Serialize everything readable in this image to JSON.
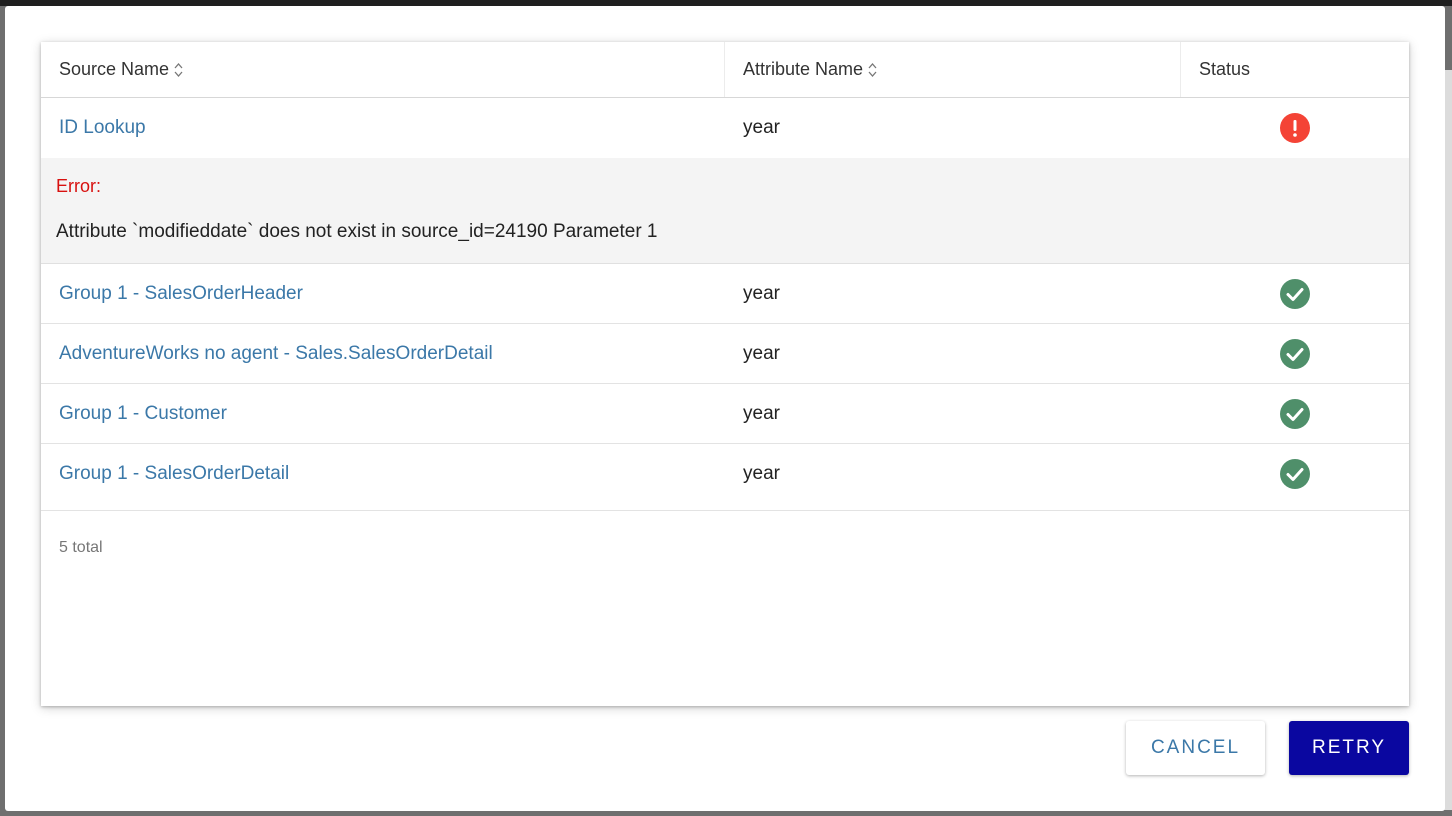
{
  "table": {
    "headers": {
      "source": "Source Name",
      "attribute": "Attribute Name",
      "status": "Status"
    },
    "rows": [
      {
        "source": "ID Lookup",
        "attribute": "year",
        "status": "error"
      },
      {
        "source": "Group 1 - SalesOrderHeader",
        "attribute": "year",
        "status": "success"
      },
      {
        "source": "AdventureWorks no agent - Sales.SalesOrderDetail",
        "attribute": "year",
        "status": "success"
      },
      {
        "source": "Group 1 - Customer",
        "attribute": "year",
        "status": "success"
      },
      {
        "source": "Group 1 - SalesOrderDetail",
        "attribute": "year",
        "status": "success"
      }
    ],
    "error": {
      "label": "Error:",
      "message": "Attribute `modifieddate` does not exist in source_id=24190 Parameter 1"
    },
    "total": "5 total"
  },
  "actions": {
    "cancel_label": "CANCEL",
    "retry_label": "RETRY"
  },
  "colors": {
    "link": "#3b78a8",
    "error_red": "#f44336",
    "success_green": "#4f8f6a",
    "primary_button": "#0a07a0"
  },
  "icons": {
    "error": "exclamation-circle-icon",
    "success": "check-circle-icon",
    "sort": "sort-icon"
  }
}
